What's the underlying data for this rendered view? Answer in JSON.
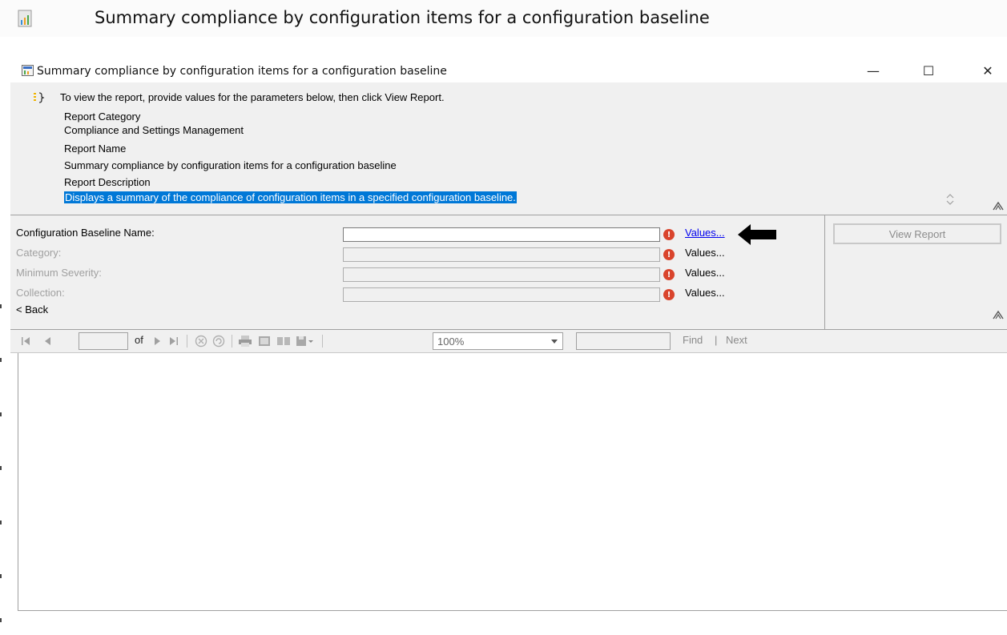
{
  "outer_window": {
    "title": "Summary compliance by configuration items for a configuration baseline"
  },
  "dialog": {
    "title": "Summary compliance by configuration items for a configuration baseline",
    "controls": {
      "minimize": "—",
      "maximize": "☐",
      "close": "✕"
    }
  },
  "info": {
    "intro": "To view the report, provide values for the parameters below, then click View Report.",
    "report_category_label": "Report Category",
    "report_category_value": "Compliance and Settings Management",
    "report_name_label": "Report Name",
    "report_name_value": "Summary compliance by configuration items for a configuration baseline",
    "report_description_label": "Report Description",
    "report_description_value": "Displays a summary of the compliance of configuration items in a specified configuration baseline."
  },
  "parameters": [
    {
      "label": "Configuration Baseline Name:",
      "values_label": "Values...",
      "enabled": true
    },
    {
      "label": "Category:",
      "values_label": "Values...",
      "enabled": false
    },
    {
      "label": "Minimum Severity:",
      "values_label": "Values...",
      "enabled": false
    },
    {
      "label": "Collection:",
      "values_label": "Values...",
      "enabled": false
    }
  ],
  "back_label": "< Back",
  "view_report_label": "View Report",
  "toolbar": {
    "of_label": "of",
    "zoom": "100%",
    "find_label": "Find",
    "next_label": "Next",
    "separator": "|"
  },
  "colors": {
    "selection": "#0078d7",
    "panel_bg": "#f0f0f0",
    "warning": "#d9442c",
    "link": "#0000ee"
  }
}
